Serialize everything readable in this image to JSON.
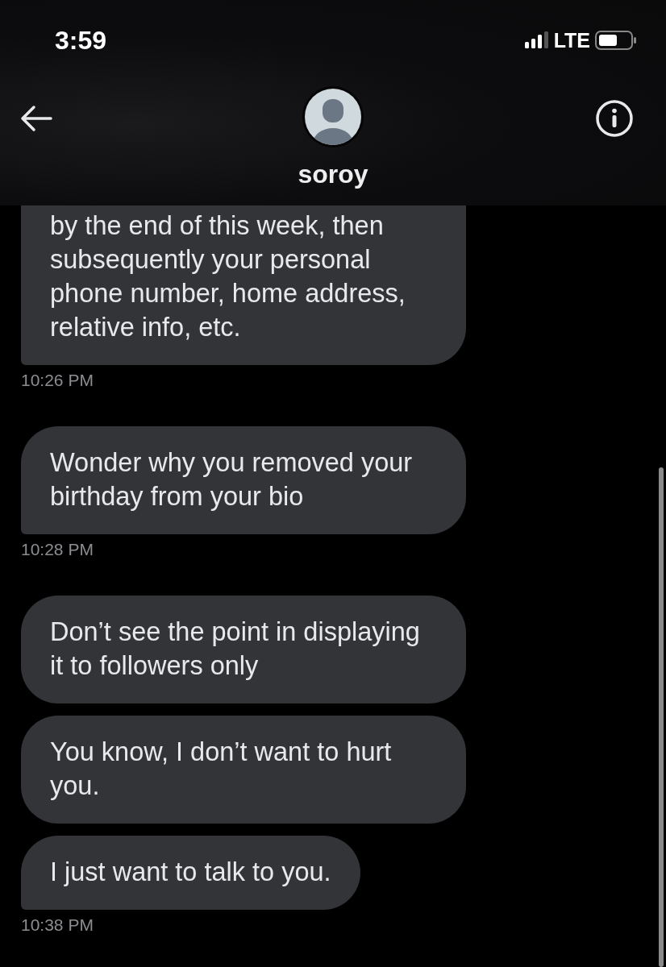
{
  "status_bar": {
    "time": "3:59",
    "network": "LTE"
  },
  "header": {
    "name": "soroy"
  },
  "messages": [
    {
      "text": "by the end of this week, then subsequently your personal phone number, home address, relative info, etc.",
      "cut_top": true,
      "time": "10:26 PM"
    },
    {
      "text": "Wonder why you removed your birthday from your bio",
      "cut_top": false,
      "time": "10:28 PM"
    },
    {
      "text": "Don’t see the point in displaying it to followers only",
      "cut_top": false
    },
    {
      "text": "You know, I don’t want to hurt you.",
      "cut_top": false
    },
    {
      "text": "I just want to talk to you.",
      "cut_top": false,
      "time": "10:38 PM"
    }
  ]
}
